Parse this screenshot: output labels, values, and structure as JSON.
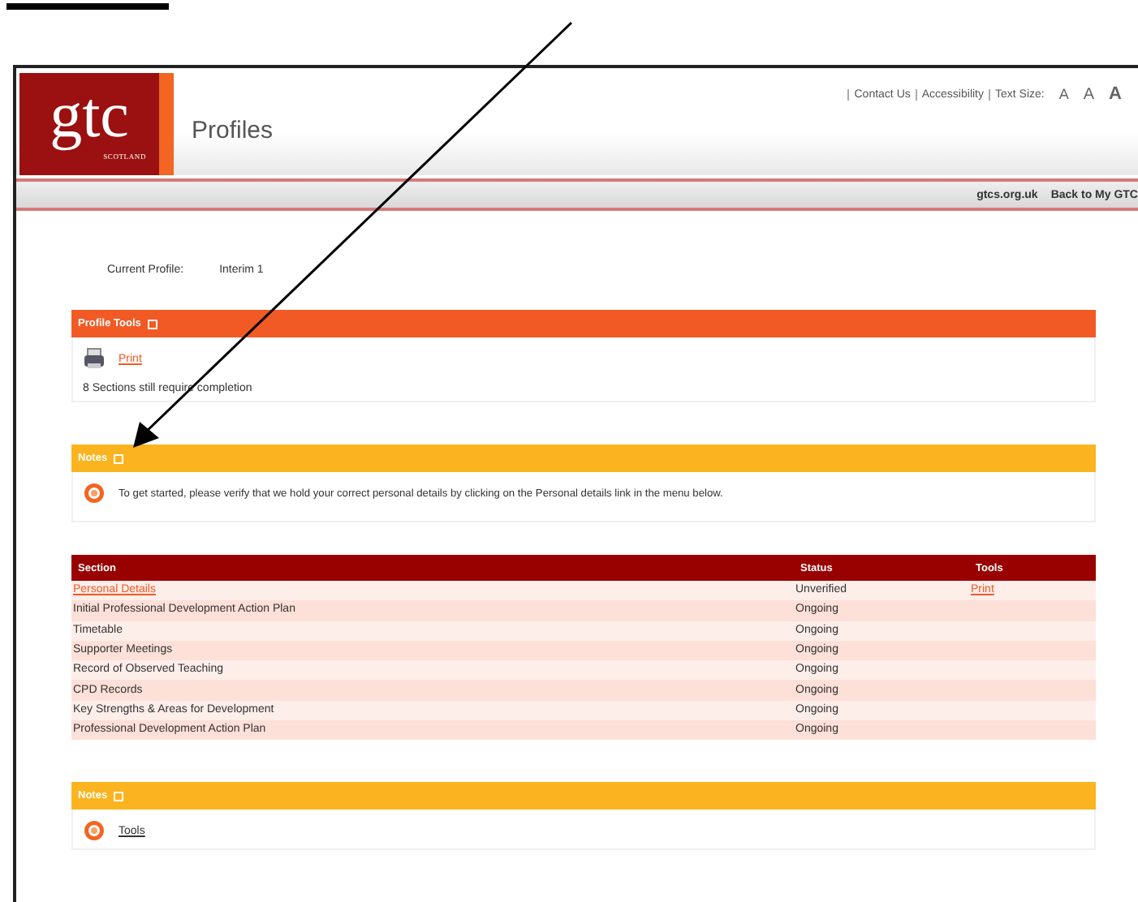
{
  "header": {
    "logo": {
      "text": "gtc",
      "subtext": "SCOTLAND"
    },
    "title": "Profiles",
    "top_links": [
      "Contact Us",
      "Accessibility"
    ],
    "text_size": {
      "label": "Text Size:",
      "sizes": [
        "A",
        "A",
        "A"
      ]
    },
    "nav_links": [
      "gtcs.org.uk",
      "Back to My GTC"
    ]
  },
  "current_profile": {
    "label": "Current Profile:",
    "value": "Interim 1"
  },
  "profile_tools": {
    "title": "Profile Tools",
    "link": "Print",
    "message": "8 Sections still require completion"
  },
  "notes": {
    "title": "Notes",
    "message": "To get started, please verify that we hold your correct personal details by clicking on the Personal details link in the menu below."
  },
  "table": {
    "columns": [
      "Section",
      "Status",
      "Tools"
    ],
    "rows": [
      {
        "section": "Personal Details",
        "link": true,
        "status": "Unverified",
        "tools": "Print"
      },
      {
        "section": "Initial Professional Development Action Plan",
        "link": false,
        "status": "Ongoing"
      },
      {
        "section": "Timetable",
        "link": false,
        "status": "Ongoing"
      },
      {
        "section": "Supporter Meetings",
        "link": false,
        "status": "Ongoing"
      },
      {
        "section": "Record of Observed Teaching",
        "link": false,
        "status": "Ongoing"
      },
      {
        "section": "CPD Records",
        "link": false,
        "status": "Ongoing"
      },
      {
        "section": "Key Strengths & Areas for Development",
        "link": false,
        "status": "Ongoing"
      },
      {
        "section": "Professional Development Action Plan",
        "link": false,
        "status": "Ongoing"
      }
    ]
  },
  "notes_2": {
    "title": "Notes",
    "link": "Tools"
  }
}
